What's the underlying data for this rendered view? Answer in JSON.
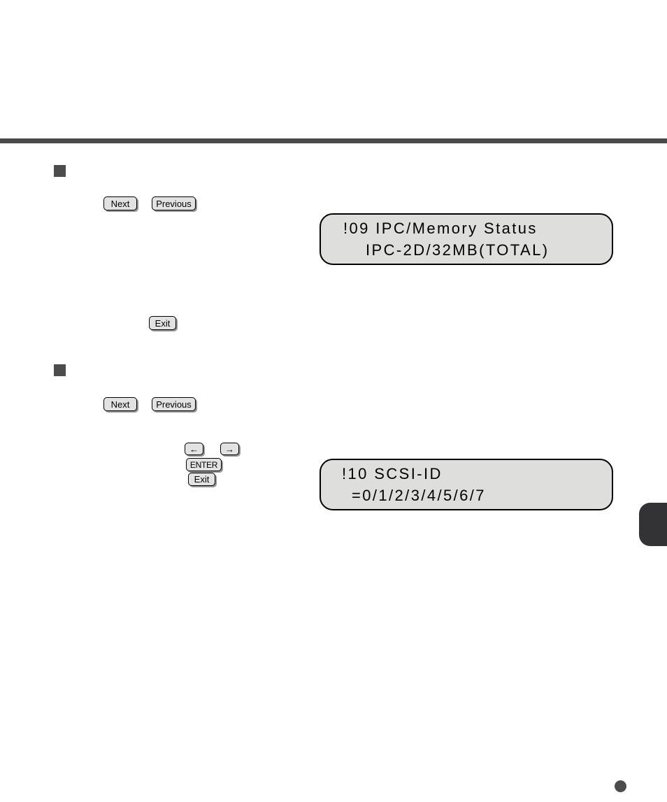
{
  "page": {
    "background_color": "#ffffff",
    "rule_color": "#4a4a4c",
    "accent_dark": "#4c4c4e",
    "lcd_fill": "#dededd",
    "key_fill": "#e2e2e2"
  },
  "sections": [
    {
      "bullet": "square-bullet",
      "keys": [
        {
          "name": "next",
          "label": "Next"
        },
        {
          "name": "previous",
          "label": "Previous"
        },
        {
          "name": "exit",
          "label": "Exit"
        }
      ],
      "display": {
        "line1": "!09 IPC/Memory Status",
        "line2": "IPC-2D/32MB(TOTAL)"
      }
    },
    {
      "bullet": "square-bullet",
      "keys": [
        {
          "name": "next",
          "label": "Next"
        },
        {
          "name": "previous",
          "label": "Previous"
        },
        {
          "name": "arrow-left",
          "label": "←"
        },
        {
          "name": "arrow-right",
          "label": "→"
        },
        {
          "name": "enter",
          "label": "ENTER"
        },
        {
          "name": "exit",
          "label": "Exit"
        }
      ],
      "display": {
        "line1": "!10 SCSI-ID",
        "line2": "=0/1/2/3/4/5/6/7"
      }
    }
  ],
  "edge_tab": {
    "name": "edge-thumb-tab"
  },
  "page_marker": {
    "name": "page-dot"
  }
}
